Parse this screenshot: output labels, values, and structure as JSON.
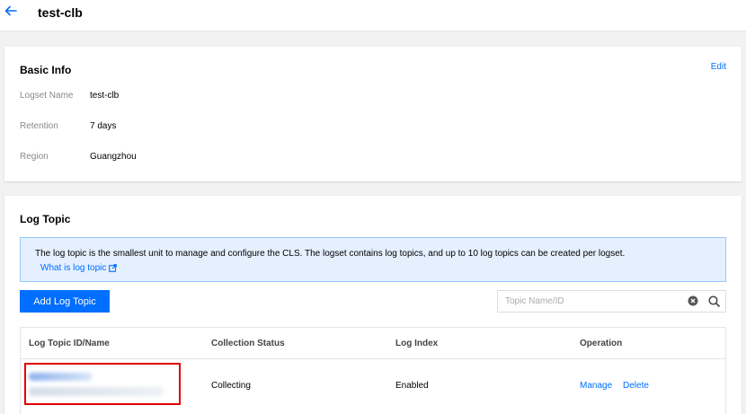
{
  "header": {
    "title": "test-clb",
    "back_icon": "arrow-left-icon"
  },
  "basic_info": {
    "title": "Basic Info",
    "edit_label": "Edit",
    "fields": [
      {
        "label": "Logset Name",
        "value": "test-clb"
      },
      {
        "label": "Retention",
        "value": "7 days"
      },
      {
        "label": "Region",
        "value": "Guangzhou"
      }
    ]
  },
  "log_topic": {
    "title": "Log Topic",
    "notice_text": "The log topic is the smallest unit to manage and configure the CLS. The logset contains log topics, and up to 10 log topics can be created per logset.",
    "notice_link": "What is log topic",
    "add_button": "Add Log Topic",
    "search_placeholder": "Topic Name/ID",
    "columns": [
      "Log Topic ID/Name",
      "Collection Status",
      "Log Index",
      "Operation"
    ],
    "rows": [
      {
        "status": "Collecting",
        "index": "Enabled",
        "manage": "Manage",
        "delete": "Delete"
      }
    ]
  },
  "colors": {
    "accent": "#006eff",
    "notice_bg": "#e5f0ff",
    "highlight": "#e00000"
  }
}
